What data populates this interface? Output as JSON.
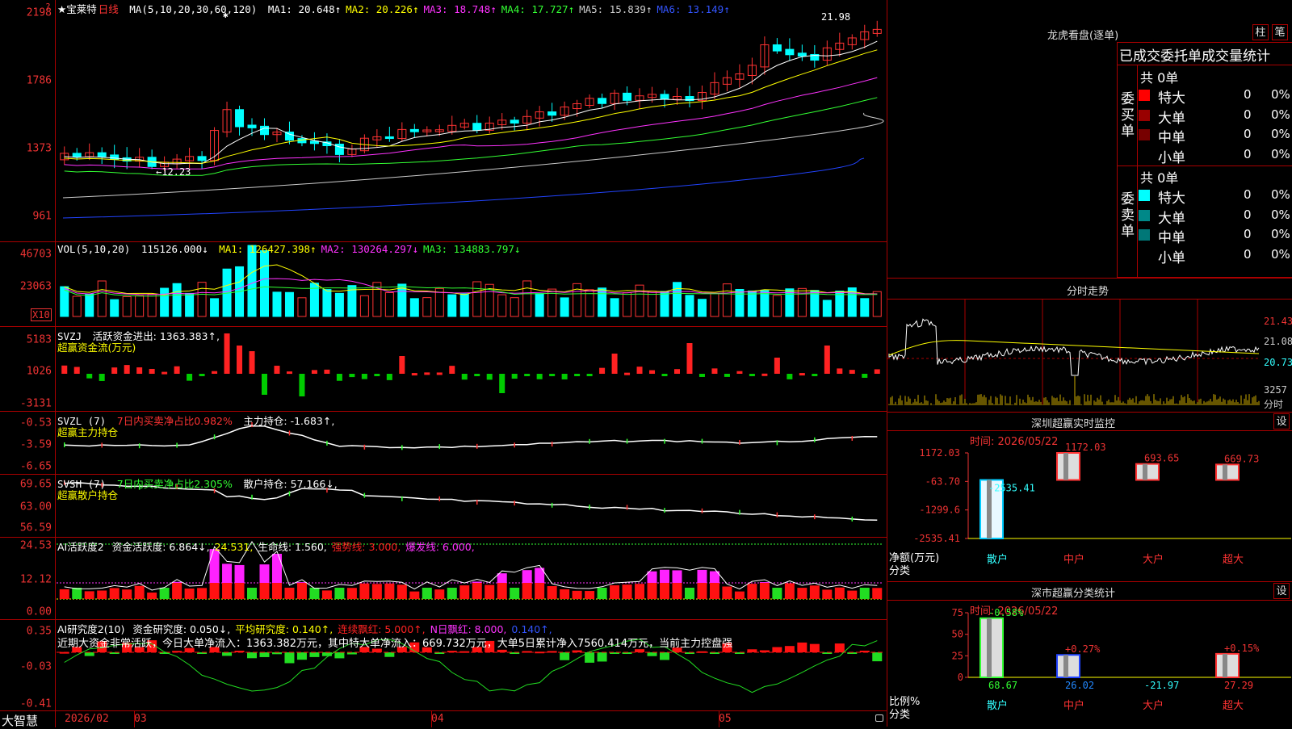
{
  "main": {
    "stock_name": "★宝莱特",
    "period": "日线",
    "ma_label": "MA(5,10,20,30,60,120)",
    "mas": [
      {
        "label": "MA1: 20.648↑",
        "color": "#ffffff"
      },
      {
        "label": "MA2: 20.226↑",
        "color": "#ffff00"
      },
      {
        "label": "MA3: 18.748↑",
        "color": "#ff33ff"
      },
      {
        "label": "MA4: 17.727↑",
        "color": "#33ff33"
      },
      {
        "label": "MA5: 15.839↑",
        "color": "#cccccc"
      },
      {
        "label": "MA6: 13.149↑",
        "color": "#3355ff"
      }
    ],
    "y_ticks": [
      "2198",
      "1786",
      "1373",
      "961"
    ],
    "high_label": "21.98",
    "low_label": "←12.23",
    "star": "✱"
  },
  "vol": {
    "label": "VOL(5,10,20)",
    "value": "115126.000↓",
    "mas": [
      {
        "label": "MA1: 126427.398↑",
        "color": "#ffff00"
      },
      {
        "label": "MA2: 130264.297↓",
        "color": "#ff33ff"
      },
      {
        "label": "MA3: 134883.797↓",
        "color": "#33ff33"
      }
    ],
    "y_ticks": [
      "46703",
      "23063"
    ],
    "unit": "X10"
  },
  "svzj": {
    "label": "SVZJ",
    "desc": "活跃资金进出: 1363.383↑,",
    "subtitle": "超赢资金流(万元)",
    "y_ticks": [
      "5183",
      "1026",
      "-3131"
    ]
  },
  "svzl": {
    "label": "SVZL (7)",
    "desc1": "7日内买卖净占比0.982%",
    "desc2": "主力持仓: -1.683↑,",
    "subtitle": "超赢主力持仓",
    "y_ticks": [
      "-0.53",
      "-3.59",
      "-6.65"
    ]
  },
  "svsh": {
    "label": "SVSH (7)",
    "desc1": "7日内买卖净占比2.305%",
    "desc2": "散户持仓: 57.166↓,",
    "subtitle": "超赢散户持仓",
    "y_ticks": [
      "69.65",
      "63.00",
      "56.59"
    ]
  },
  "ai1": {
    "label": "AI活跃度2",
    "parts": [
      {
        "label": "资金活跃度: 6.864↓,",
        "color": "#ffffff"
      },
      {
        "label": "24.531,",
        "color": "#ffff00"
      },
      {
        "label": "生命线: 1.560,",
        "color": "#ffffff"
      },
      {
        "label": "强势线: 3.000,",
        "color": "#ff2222"
      },
      {
        "label": "爆发线: 6.000,",
        "color": "#ff33ff"
      }
    ],
    "y_ticks": [
      "24.53",
      "12.12",
      "0.00"
    ]
  },
  "ai2": {
    "label": "AI研究度2(10)",
    "parts": [
      {
        "label": "资金研究度: 0.050↓,",
        "color": "#ffffff"
      },
      {
        "label": "平均研究度: 0.140↑,",
        "color": "#ffff00"
      },
      {
        "label": "连续飘红: 5.000↑,",
        "color": "#ff2222"
      },
      {
        "label": "N日飘红: 8.000,",
        "color": "#ff33ff"
      },
      {
        "label": "0.140↑,",
        "color": "#3355ff"
      }
    ],
    "commentary": "近期大资金非常活跃，今日大单净流入：1363.382万元，其中特大单净流入：669.732万元，大单5日累计净入7560.414万元，当前主力控盘强",
    "y_ticks": [
      "0.35",
      "-0.03",
      "-0.41"
    ]
  },
  "xaxis": {
    "brand": "大智慧",
    "labels": [
      {
        "t": "2026/02"
      },
      {
        "t": "03"
      },
      {
        "t": "04"
      },
      {
        "t": "05"
      }
    ]
  },
  "right": {
    "lhb_title": "龙虎看盘(逐单)",
    "btn_zhu": "柱",
    "btn_bi": "笔",
    "lhb_sub": "已成交委托单成交量统计",
    "buy_label": "委买单",
    "sell_label": "委卖单",
    "buy_total": "共 0单",
    "sell_total": "共 0单",
    "buy_rows": [
      {
        "name": "特大",
        "qty": "0",
        "pct": "0%",
        "color": "#ff0000"
      },
      {
        "name": "大单",
        "qty": "0",
        "pct": "0%",
        "color": "#990000"
      },
      {
        "name": "中单",
        "qty": "0",
        "pct": "0%",
        "color": "#770000"
      },
      {
        "name": "小单",
        "qty": "0",
        "pct": "0%",
        "color": ""
      }
    ],
    "sell_rows": [
      {
        "name": "特大",
        "qty": "0",
        "pct": "0%",
        "color": "#00ffff"
      },
      {
        "name": "大单",
        "qty": "0",
        "pct": "0%",
        "color": "#008888"
      },
      {
        "name": "中单",
        "qty": "0",
        "pct": "0%",
        "color": "#007777"
      },
      {
        "name": "小单",
        "qty": "0",
        "pct": "0%",
        "color": ""
      }
    ],
    "fs_title": "分时走势",
    "fs_prices": [
      "21.43",
      "21.08",
      "20.73"
    ],
    "fs_vol": "3257",
    "fs_unit": "分时",
    "sz_title": "深圳超赢实时监控",
    "sz_btn": "设",
    "sz_time": "时间: 2026/05/22",
    "sz_ticks": [
      "1172.03",
      "-63.70",
      "-1299.6",
      "-2535.41"
    ],
    "sz_cats": [
      "散户",
      "中户",
      "大户",
      "超大"
    ],
    "sz_values": [
      -2535.41,
      1172.03,
      693.65,
      669.73
    ],
    "sz_labels": [
      "-2535.41",
      "1172.03",
      "693.65",
      "669.73"
    ],
    "sz_axis_label": "净额(万元)",
    "sz_cat_label": "分类",
    "sc_title": "深市超赢分类统计",
    "sc_btn": "设",
    "sc_time": "时间: 2026/05/22",
    "sc_ticks": [
      "75",
      "50",
      "25",
      "0"
    ],
    "sc_cats": [
      "散户",
      "中户",
      "大户",
      "超大"
    ],
    "sc_values": [
      68.67,
      26.02,
      -21.97,
      27.29
    ],
    "sc_value_labels": [
      "68.67",
      "26.02",
      "-21.97",
      "27.29"
    ],
    "sc_pct_labels": [
      "-0.58%",
      "+0.27%",
      "",
      "+0.15%"
    ],
    "sc_axis_label": "比例%",
    "sc_cat_label": "分类"
  }
}
